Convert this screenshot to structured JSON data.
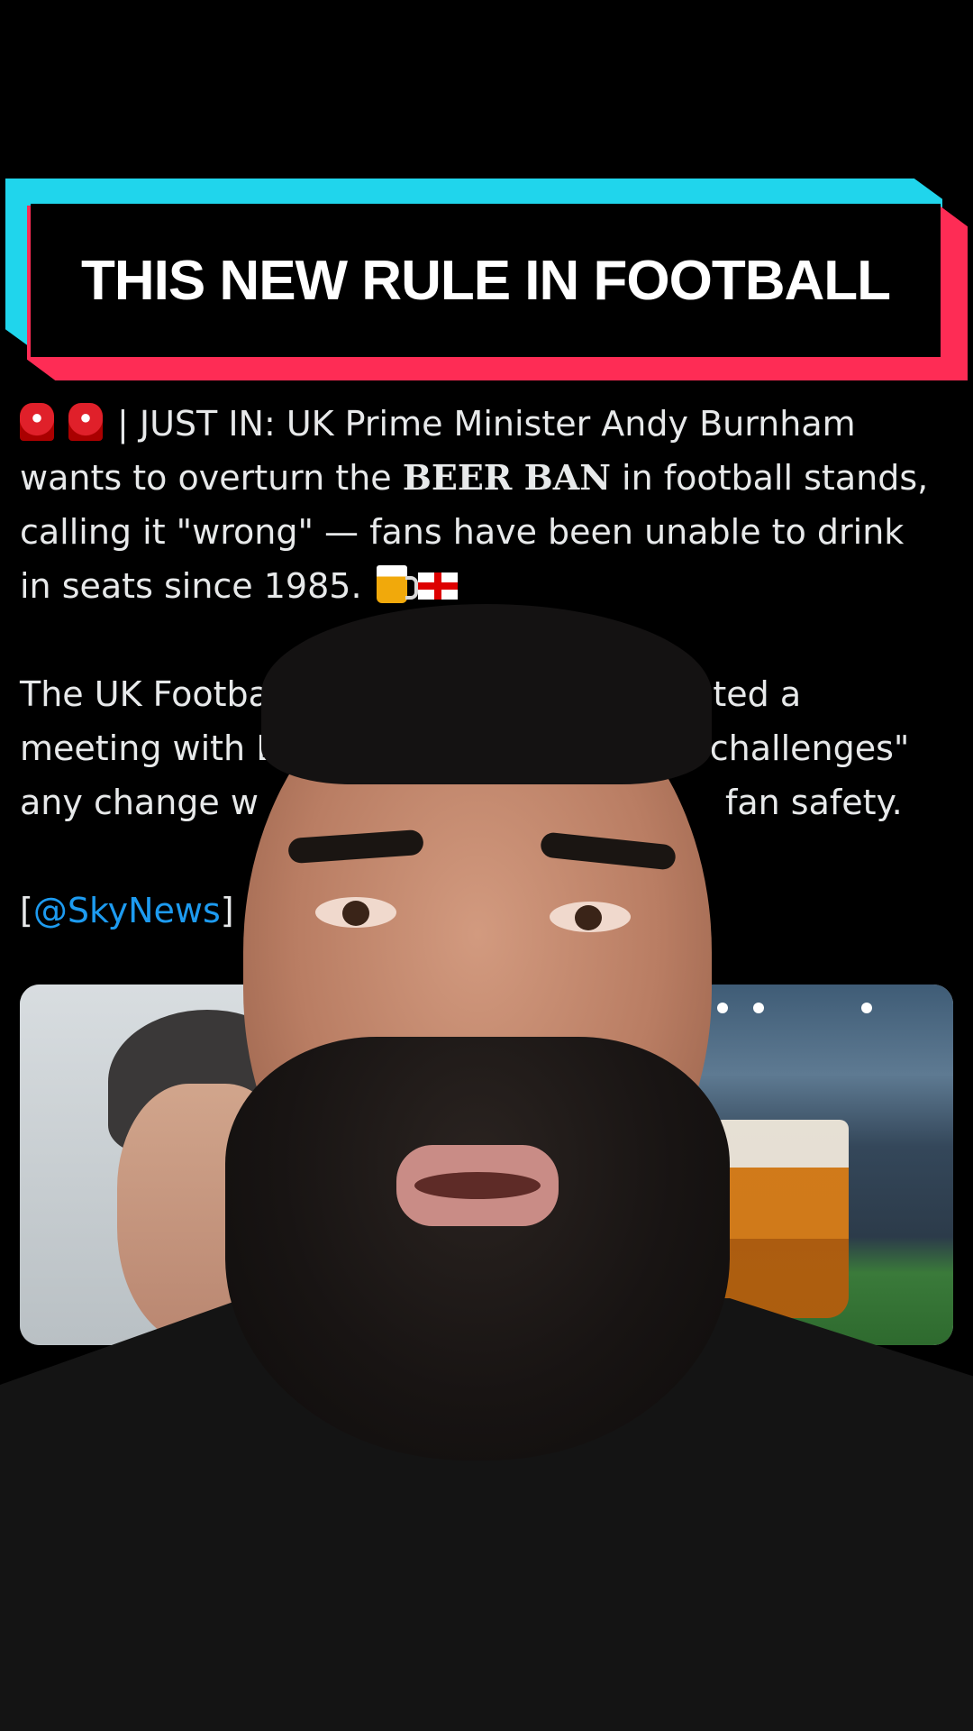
{
  "headline": {
    "text": "THIS NEW RULE IN FOOTBALL"
  },
  "tweet": {
    "line1_prefix": "| JUST IN: UK Prime Minister Andy Burnham",
    "line2_before": "wants to overturn the ",
    "beer_ban": "BEER BAN",
    "line2_after": " in football stands,",
    "line3": "calling it \"wrong\" — fans have been unable to drink",
    "line4": "in seats since 1985.",
    "para2_line1": "The UK Football",
    "para2_line1_end": "quested a",
    "para2_line2": "meeting with B",
    "para2_line2_end": "\"challenges\"",
    "para2_line3": "any change w",
    "para2_line3_end": "fan safety.",
    "source_open": "[",
    "source_mention": "@SkyNews",
    "source_close": "]"
  },
  "icons": {
    "siren": "police-light-icon",
    "beer": "beer-mug-icon",
    "flag": "england-flag-icon"
  },
  "colors": {
    "cyan": "#20d5ec",
    "red": "#fe2c55",
    "mention": "#1d9bf0",
    "text": "#e7e9ea"
  }
}
